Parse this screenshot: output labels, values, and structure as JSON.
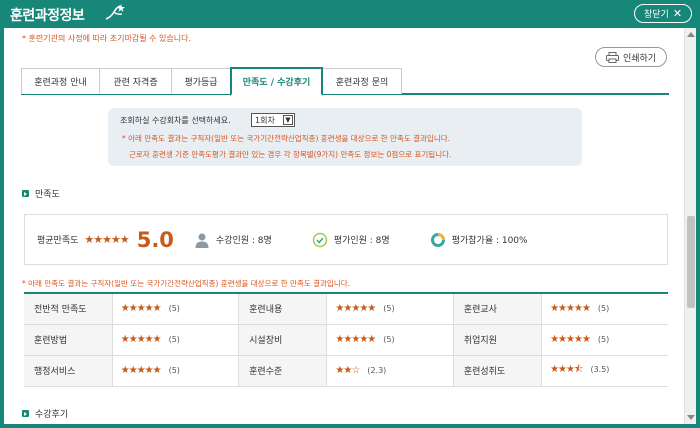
{
  "window": {
    "title": "훈련과정정보",
    "close_label": "창닫기"
  },
  "notice_top": "* 훈련기관의 사정에 따라 조기마감될 수 있습니다.",
  "print_label": "인쇄하기",
  "tabs": [
    {
      "label": "훈련과정 안내"
    },
    {
      "label": "관련 자격증"
    },
    {
      "label": "평가등급"
    },
    {
      "label": "만족도 / 수강후기"
    },
    {
      "label": "훈련과정 문의"
    }
  ],
  "active_tab": "만족도 / 수강후기",
  "infobox": {
    "select_label": "조회하실 수강회차를 선택하세요.",
    "select_value": "1회차",
    "line1": "* 아래 만족도 결과는 구직자(일반 또는 국가기간전략산업직종) 훈련생을 대상으로 한 만족도 결과입니다.",
    "line2": "근로자 훈련생 기준 만족도평가 결과만 있는 경우 각 항목별(9가지) 만족도 정보는 0점으로 표기됩니다."
  },
  "satisfaction": {
    "heading": "만족도",
    "avg_label": "평균만족도",
    "avg_stars": "★★★★★",
    "avg_score": "5.0",
    "enrolled": "수강인원 : 8명",
    "evaluated": "평가인원 : 8명",
    "participation": "평가참가율 : 100%"
  },
  "notice_mid": "* 아래 만족도 결과는 구직자(일반 또는 국가기간전략산업직종) 훈련생을 대상으로 한 만족도 결과입니다.",
  "ratings": [
    [
      {
        "label": "전반적 만족도",
        "stars": "★★★★★",
        "score": "(5)"
      },
      {
        "label": "훈련내용",
        "stars": "★★★★★",
        "score": "(5)"
      },
      {
        "label": "훈련교사",
        "stars": "★★★★★",
        "score": "(5)"
      }
    ],
    [
      {
        "label": "훈련방법",
        "stars": "★★★★★",
        "score": "(5)"
      },
      {
        "label": "시설장비",
        "stars": "★★★★★",
        "score": "(5)"
      },
      {
        "label": "취업지원",
        "stars": "★★★★★",
        "score": "(5)"
      }
    ],
    [
      {
        "label": "행정서비스",
        "stars": "★★★★★",
        "score": "(5)"
      },
      {
        "label": "훈련수준",
        "stars": "★★☆",
        "score": "(2.3)"
      },
      {
        "label": "훈련성취도",
        "stars": "★★★⯪",
        "score": "(3.5)"
      }
    ]
  ],
  "reviews_heading": "수강후기",
  "colors": {
    "brand": "#17877a",
    "accent": "#c85a1a",
    "notice": "#d9541e"
  }
}
